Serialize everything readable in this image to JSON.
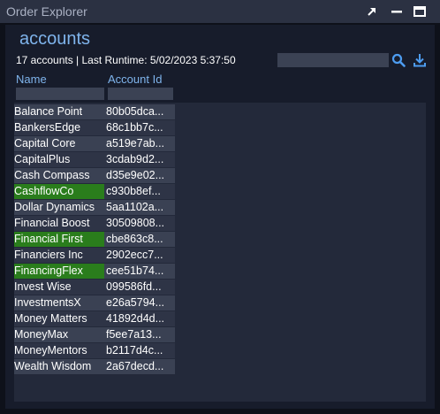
{
  "window": {
    "title": "Order Explorer"
  },
  "panel": {
    "title": "accounts",
    "subtitle": "17 accounts | Last Runtime: 5/02/2023 5:37:50",
    "search": {
      "value": "",
      "placeholder": ""
    }
  },
  "columns": [
    {
      "label": "Name"
    },
    {
      "label": "Account Id"
    }
  ],
  "rows": [
    {
      "name": "Balance Point",
      "id": "80b05dca...",
      "selected": false
    },
    {
      "name": "BankersEdge",
      "id": "68c1bb7c...",
      "selected": false
    },
    {
      "name": "Capital Core",
      "id": "a519e7ab...",
      "selected": false
    },
    {
      "name": "CapitalPlus",
      "id": "3cdab9d2...",
      "selected": false
    },
    {
      "name": "Cash Compass",
      "id": "d35e9e02...",
      "selected": false
    },
    {
      "name": "CashflowCo",
      "id": "c930b8ef...",
      "selected": true
    },
    {
      "name": "Dollar Dynamics",
      "id": "5aa1102a...",
      "selected": false
    },
    {
      "name": "Financial Boost",
      "id": "30509808...",
      "selected": false
    },
    {
      "name": "Financial First",
      "id": "cbe863c8...",
      "selected": true
    },
    {
      "name": "Financiers Inc",
      "id": "2902ecc7...",
      "selected": false
    },
    {
      "name": "FinancingFlex",
      "id": "cee51b74...",
      "selected": true
    },
    {
      "name": "Invest Wise",
      "id": "099586fd...",
      "selected": false
    },
    {
      "name": "InvestmentsX",
      "id": "e26a5794...",
      "selected": false
    },
    {
      "name": "Money Matters",
      "id": "41892d4d...",
      "selected": false
    },
    {
      "name": "MoneyMax",
      "id": "f5ee7a13...",
      "selected": false
    },
    {
      "name": "MoneyMentors",
      "id": "b2117d4c...",
      "selected": false
    },
    {
      "name": "Wealth Wisdom",
      "id": "2a67decd...",
      "selected": false
    }
  ],
  "icons": {
    "popout": "popout-icon",
    "minimize": "minimize-icon",
    "maximize": "maximize-icon",
    "search": "search-icon",
    "download": "download-icon"
  },
  "colors": {
    "accent": "#7fb4ec",
    "selected_row": "#2a7d1c",
    "titlebar": "#2b3142"
  }
}
